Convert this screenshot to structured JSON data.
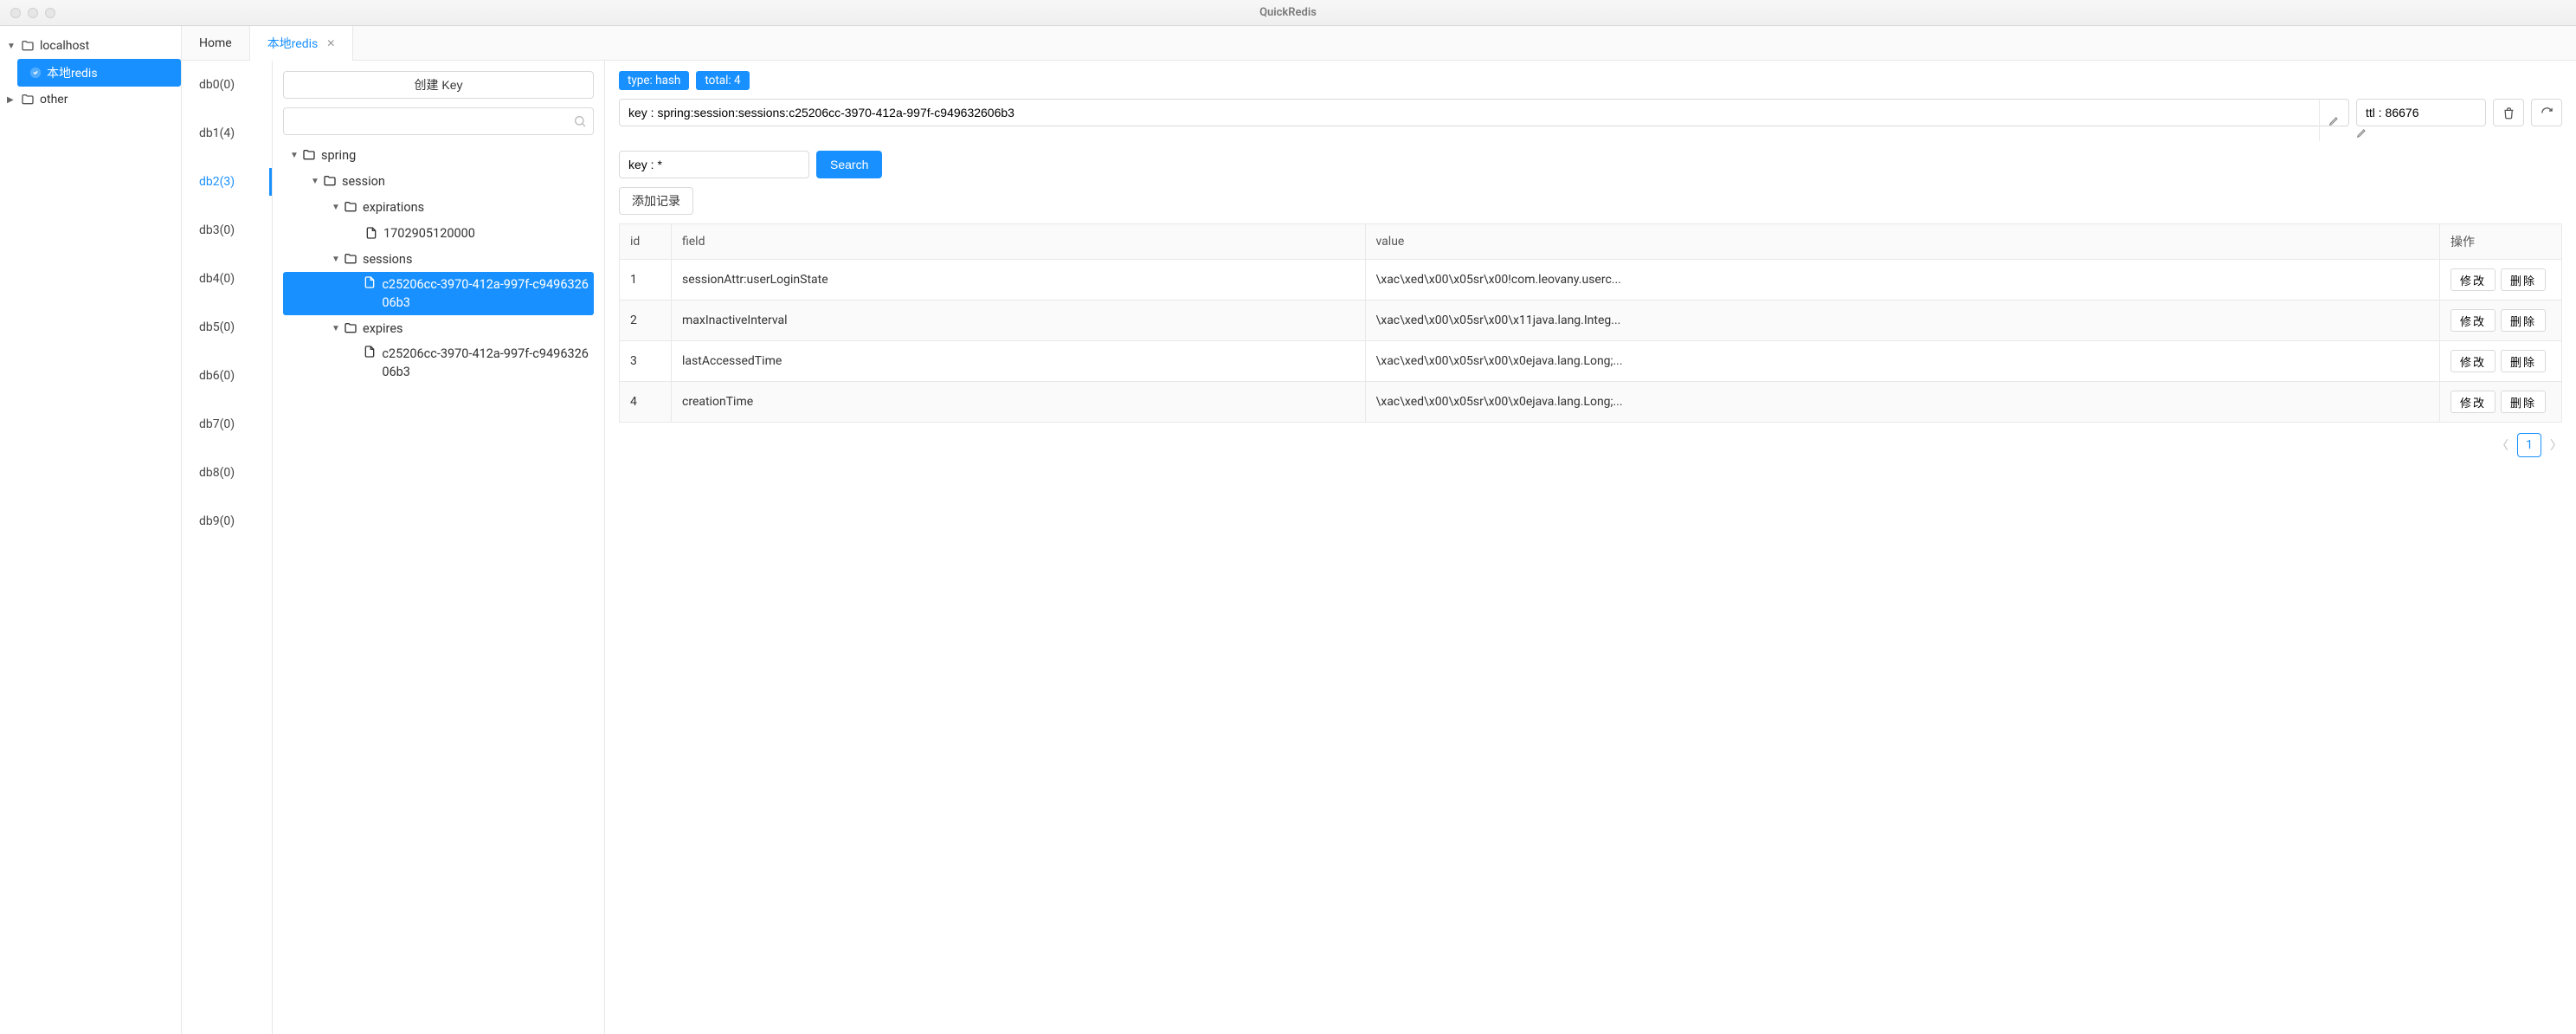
{
  "window": {
    "title": "QuickRedis"
  },
  "connections": {
    "items": [
      {
        "name": "localhost",
        "expanded": true,
        "active_child": "本地redis"
      },
      {
        "name": "other",
        "expanded": false
      }
    ]
  },
  "tabs": {
    "items": [
      {
        "label": "Home",
        "active": false,
        "closable": false
      },
      {
        "label": "本地redis",
        "active": true,
        "closable": true
      }
    ]
  },
  "dbs": {
    "items": [
      {
        "label": "db0(0)"
      },
      {
        "label": "db1(4)"
      },
      {
        "label": "db2(3)",
        "active": true
      },
      {
        "label": "db3(0)"
      },
      {
        "label": "db4(0)"
      },
      {
        "label": "db5(0)"
      },
      {
        "label": "db6(0)"
      },
      {
        "label": "db7(0)"
      },
      {
        "label": "db8(0)"
      },
      {
        "label": "db9(0)"
      }
    ]
  },
  "keypanel": {
    "create_label": "创建 Key",
    "search_value": "",
    "tree": [
      {
        "level": 0,
        "type": "folder",
        "label": "spring",
        "expanded": true
      },
      {
        "level": 1,
        "type": "folder",
        "label": "session",
        "expanded": true
      },
      {
        "level": 2,
        "type": "folder",
        "label": "expirations",
        "expanded": true
      },
      {
        "level": 3,
        "type": "file",
        "label": "1702905120000"
      },
      {
        "level": 2,
        "type": "folder",
        "label": "sessions",
        "expanded": true
      },
      {
        "level": 3,
        "type": "file",
        "label": "c25206cc-3970-412a-997f-c949632606b3",
        "selected": true
      },
      {
        "level": 2,
        "type": "folder",
        "label": "expires",
        "expanded": true
      },
      {
        "level": 3,
        "type": "file",
        "label": "c25206cc-3970-412a-997f-c949632606b3"
      }
    ]
  },
  "detail": {
    "badges": {
      "type_label": "type: hash",
      "total_label": "total: 4"
    },
    "key_value": "key : spring:session:sessions:c25206cc-3970-412a-997f-c949632606b3",
    "ttl_value": "ttl : 86676",
    "filter_value": "key : *",
    "search_label": "Search",
    "add_label": "添加记录",
    "columns": {
      "id": "id",
      "field": "field",
      "value": "value",
      "ops": "操作"
    },
    "rows": [
      {
        "id": "1",
        "field": "sessionAttr:userLoginState",
        "value": "\\xac\\xed\\x00\\x05sr\\x00!com.leovany.userc..."
      },
      {
        "id": "2",
        "field": "maxInactiveInterval",
        "value": "\\xac\\xed\\x00\\x05sr\\x00\\x11java.lang.Integ..."
      },
      {
        "id": "3",
        "field": "lastAccessedTime",
        "value": "\\xac\\xed\\x00\\x05sr\\x00\\x0ejava.lang.Long;..."
      },
      {
        "id": "4",
        "field": "creationTime",
        "value": "\\xac\\xed\\x00\\x05sr\\x00\\x0ejava.lang.Long;..."
      }
    ],
    "row_buttons": {
      "edit": "修改",
      "delete": "删除"
    },
    "page": "1"
  }
}
